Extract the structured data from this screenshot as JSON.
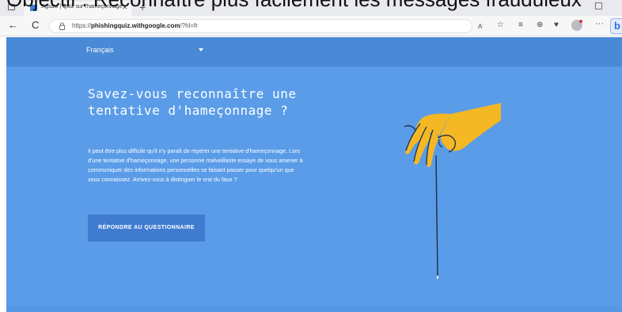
{
  "overlay": {
    "caption": "Objectif : Reconnaître plus facilement les messages frauduleux"
  },
  "browser": {
    "tab_title": "Jigsaw | Quiz sur l'hameçonnage",
    "tab_close": "✕",
    "new_tab": "+",
    "url_prefix": "https://",
    "url_domain": "phishingquiz.withgoogle.com",
    "url_suffix": "/?hl=fr",
    "back_glyph": "←",
    "refresh_glyph": "C",
    "read_aloud": "Aʾ",
    "more": "···",
    "copilot": "b",
    "icons": [
      "window-icon",
      "favicon",
      "lock-icon",
      "read-aloud-icon",
      "add-favorite-icon",
      "favorites-icon",
      "collections-icon",
      "extensions-icon",
      "profile-icon",
      "more-icon",
      "copilot-icon"
    ]
  },
  "page": {
    "language": "Français",
    "title": "Savez-vous reconnaître une tentative d'hameçonnage ?",
    "description": "Il peut être plus difficile qu'il n'y paraît de repérer une tentative d'hameçonnage. Lors d'une tentative d'hameçonnage, une personne malveillante essaye de vous amener à communiquer des informations personnelles se faisant passer pour quelqu'un que vous connaissez. Arrivez-vous à distinguer le vrai du faux ?",
    "cta": "RÉPONDRE AU QUESTIONNAIRE",
    "colors": {
      "background": "#5a9ce8",
      "language_bar": "#4a89d6",
      "button": "#3f7cd0",
      "hand": "#f4b824",
      "line": "#1d2c4c"
    }
  }
}
